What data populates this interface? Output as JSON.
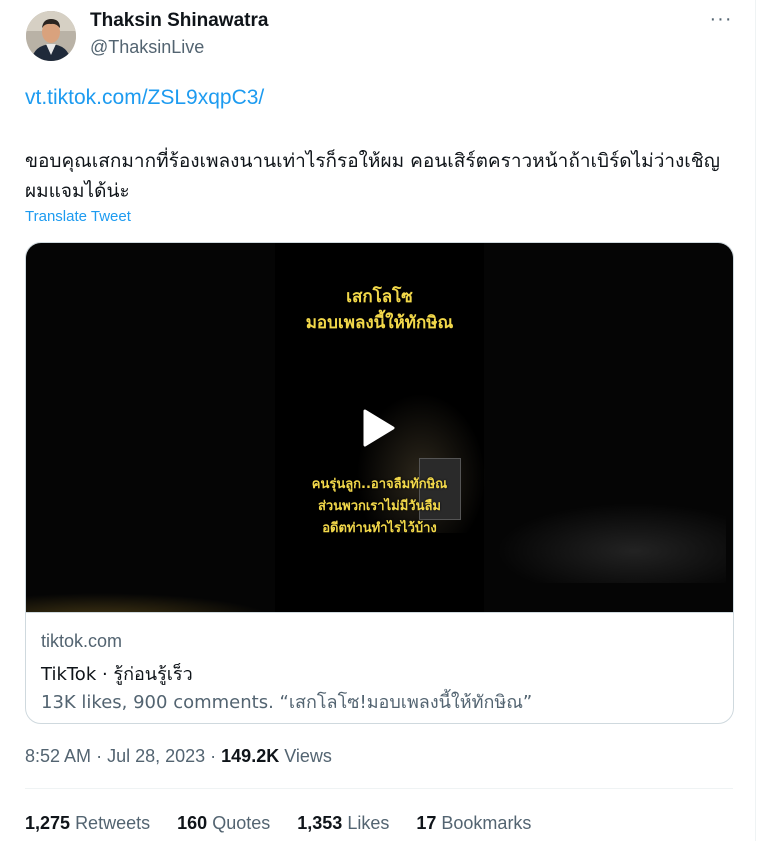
{
  "author": {
    "name": "Thaksin Shinawatra",
    "handle": "@ThaksinLive",
    "avatar_icon": "profile-photo"
  },
  "tweet": {
    "link": "vt.tiktok.com/ZSL9xqpC3/",
    "text": "ขอบคุณเสกมากที่ร้องเพลงนานเท่าไรก็รอให้ผม คอนเสิร์ตคราวหน้าถ้าเบิร์ดไม่ว่างเชิญผมแจมได้น่ะ",
    "translate_label": "Translate Tweet"
  },
  "card": {
    "video_caption_top": [
      "เสกโลโซ",
      "มอบเพลงนี้ให้ทักษิณ"
    ],
    "video_caption_bottom": [
      "คนรุ่นลูก..อาจลืมทักษิณ",
      "ส่วนพวกเราไม่มีวันลืม",
      "อดีตท่านทำไรไว้บ้าง"
    ],
    "domain": "tiktok.com",
    "title": "TikTok · รู้ก่อนรู้เร็ว",
    "description": "13K likes, 900 comments. “เสกโลโซ!มอบเพลงนี้ให้ทักษิณ”"
  },
  "meta": {
    "time": "8:52 AM",
    "date": "Jul 28, 2023",
    "views_count": "149.2K",
    "views_label": "Views"
  },
  "stats": [
    {
      "count": "1,275",
      "label": "Retweets"
    },
    {
      "count": "160",
      "label": "Quotes"
    },
    {
      "count": "1,353",
      "label": "Likes"
    },
    {
      "count": "17",
      "label": "Bookmarks"
    }
  ],
  "colors": {
    "link": "#1d9bf0",
    "secondary_text": "#536471",
    "caption": "#f2d84a"
  }
}
